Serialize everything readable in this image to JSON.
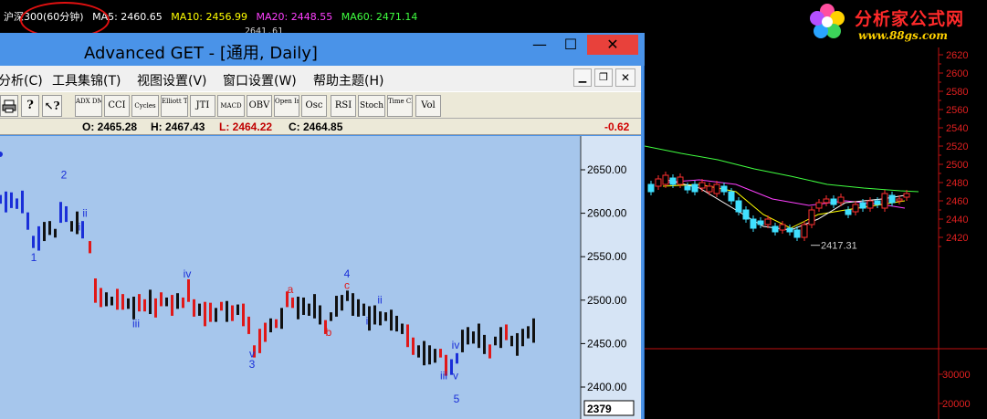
{
  "infobar": {
    "symbol": "沪深300(60分钟)",
    "ma5": "MA5: 2460.65",
    "ma10": "MA10: 2456.99",
    "ma20": "MA20: 2448.55",
    "ma60": "MA60: 2471.14",
    "partial_value": "2641.61",
    "colors": {
      "symbol": "#ffffff",
      "ma5": "#ffffff",
      "ma10": "#ffff00",
      "ma20": "#ff40ff",
      "ma60": "#40ff40"
    }
  },
  "logo": {
    "title": "分析家公式网",
    "url": "www.88gs.com"
  },
  "window": {
    "title": "Advanced GET - [通用, Daily]",
    "minimize": "—",
    "maximize": "☐",
    "close": "✕"
  },
  "menu": {
    "items": [
      "分析(C)",
      "工具集锦(T)",
      "视图设置(V)",
      "窗口设置(W)",
      "帮助主题(H)"
    ],
    "mdi_min": "▁",
    "mdi_restore": "❐",
    "mdi_close": "✕"
  },
  "toolbar": {
    "icons": [
      "print-icon",
      "help-icon",
      "context-help-icon"
    ],
    "buttons": [
      "ADX DMI",
      "CCI",
      "Cycles",
      "Elliott Trig",
      "JTI",
      "MACD",
      "OBV",
      "Open Int",
      "Osc",
      "RSI",
      "Stoch",
      "Time Clust",
      "Vol"
    ]
  },
  "ohlc": {
    "open": "O:  2465.28",
    "high": "H:  2467.43",
    "low": "L:  2464.22",
    "close": "C:  2464.85",
    "change": "-0.62",
    "colors": {
      "open": "#000000",
      "high": "#000000",
      "low": "#c00000",
      "close": "#000000",
      "change": "#d00000"
    }
  },
  "left_chart": {
    "y_ticks": [
      "2650.00",
      "2600.00",
      "2550.00",
      "2500.00",
      "2450.00",
      "2400.00"
    ],
    "last_value": "2379",
    "wave_labels": [
      {
        "text": "2",
        "color": "blue"
      },
      {
        "text": "ii",
        "color": "blue"
      },
      {
        "text": "i",
        "color": "blue"
      },
      {
        "text": "1",
        "color": "blue"
      },
      {
        "text": "iv",
        "color": "blue"
      },
      {
        "text": "iii",
        "color": "blue"
      },
      {
        "text": "v",
        "color": "blue"
      },
      {
        "text": "3",
        "color": "blue"
      },
      {
        "text": "a",
        "color": "red"
      },
      {
        "text": "4",
        "color": "blue"
      },
      {
        "text": "c",
        "color": "red"
      },
      {
        "text": "b",
        "color": "red"
      },
      {
        "text": "ii",
        "color": "blue"
      },
      {
        "text": "i",
        "color": "blue"
      },
      {
        "text": "iv",
        "color": "blue"
      },
      {
        "text": "iii",
        "color": "blue"
      },
      {
        "text": "v",
        "color": "blue"
      },
      {
        "text": "5",
        "color": "blue"
      }
    ]
  },
  "right_chart": {
    "y_ticks": [
      "2620",
      "2600",
      "2580",
      "2560",
      "2540",
      "2520",
      "2500",
      "2480",
      "2460",
      "2440",
      "2420"
    ],
    "vol_ticks": [
      "30000",
      "20000"
    ],
    "low_marker": "2417.31"
  }
}
